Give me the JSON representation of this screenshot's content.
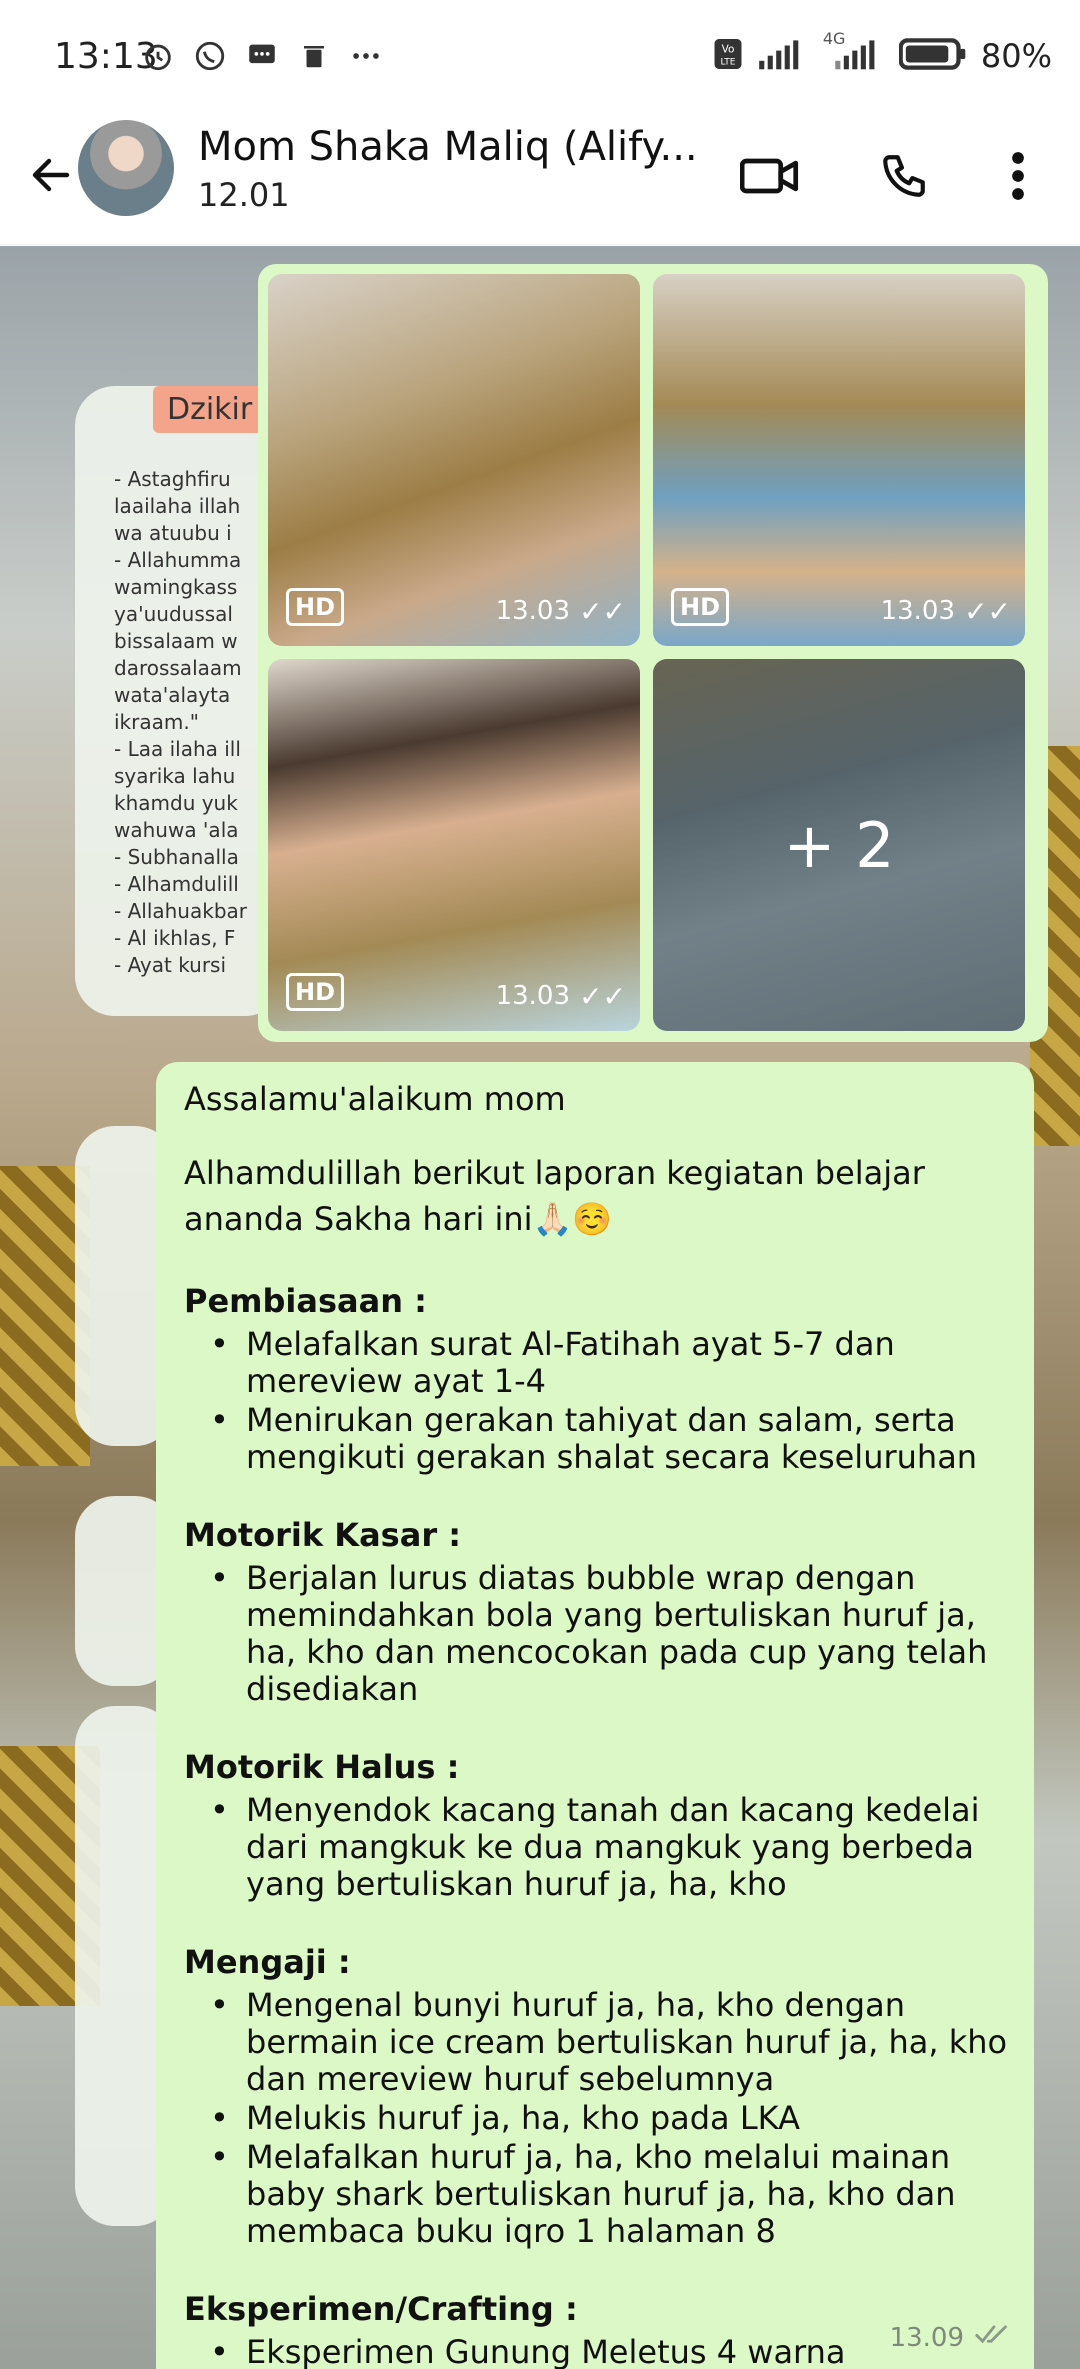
{
  "status_bar": {
    "time": "13:13",
    "battery": "80%",
    "network": "4G"
  },
  "header": {
    "contact_name": "Mom Shaka Maliq (Alify...",
    "subtitle": "12.01"
  },
  "images": {
    "thumbs": [
      {
        "hd": "HD",
        "time": "13.03",
        "status": "read"
      },
      {
        "hd": "HD",
        "time": "13.03",
        "status": "read"
      },
      {
        "hd": "HD",
        "time": "13.03",
        "status": "read"
      },
      {
        "more": "+ 2"
      }
    ]
  },
  "background_text": {
    "title": "Dzikir",
    "lines": [
      "- Astaghfiru",
      "laailaha illah",
      "wa atuubu i",
      "- Allahumma",
      "wamingkass",
      "ya'uudussal",
      "bissalaam w",
      "darossalaam",
      "wata'alayta",
      "ikraam.\"",
      "- Laa ilaha ill",
      "syarika lahu",
      "khamdu yuk",
      "wahuwa 'ala",
      "- Subhanalla",
      "- Alhamdulill",
      "- Allahuakbar",
      "- Al ikhlas, F",
      "- Ayat kursi"
    ]
  },
  "message": {
    "greeting": "Assalamu'alaikum mom",
    "intro": "Alhamdulillah berikut laporan kegiatan belajar ananda Sakha hari ini🙏🏻☺️",
    "sections": [
      {
        "title": "Pembiasaan :",
        "items": [
          "Melafalkan surat Al-Fatihah ayat 5-7 dan mereview ayat 1-4",
          "Menirukan gerakan tahiyat dan salam, serta mengikuti gerakan shalat secara keseluruhan"
        ]
      },
      {
        "title": "Motorik Kasar :",
        "items": [
          "Berjalan lurus diatas bubble wrap dengan memindahkan bola yang bertuliskan huruf ja, ha, kho dan mencocokan pada cup yang telah disediakan"
        ]
      },
      {
        "title": "Motorik Halus :",
        "items": [
          "Menyendok kacang tanah dan kacang kedelai dari mangkuk ke dua mangkuk yang berbeda yang bertuliskan huruf ja, ha, kho"
        ]
      },
      {
        "title": "Mengaji :",
        "items": [
          "Mengenal bunyi huruf ja, ha, kho dengan bermain ice cream bertuliskan huruf ja, ha, kho dan mereview huruf sebelumnya",
          "Melukis huruf ja, ha, kho pada LKA",
          "Melafalkan huruf ja, ha, kho melalui mainan baby shark bertuliskan huruf ja, ha, kho dan membaca buku iqro 1 halaman 8"
        ]
      },
      {
        "title": "Eksperimen/Crafting :",
        "items": [
          "Eksperimen Gunung Meletus 4 warna"
        ]
      }
    ],
    "time": "13.09"
  },
  "colors": {
    "bubble": "#dcf8c6",
    "header_bg": "#ffffff"
  }
}
